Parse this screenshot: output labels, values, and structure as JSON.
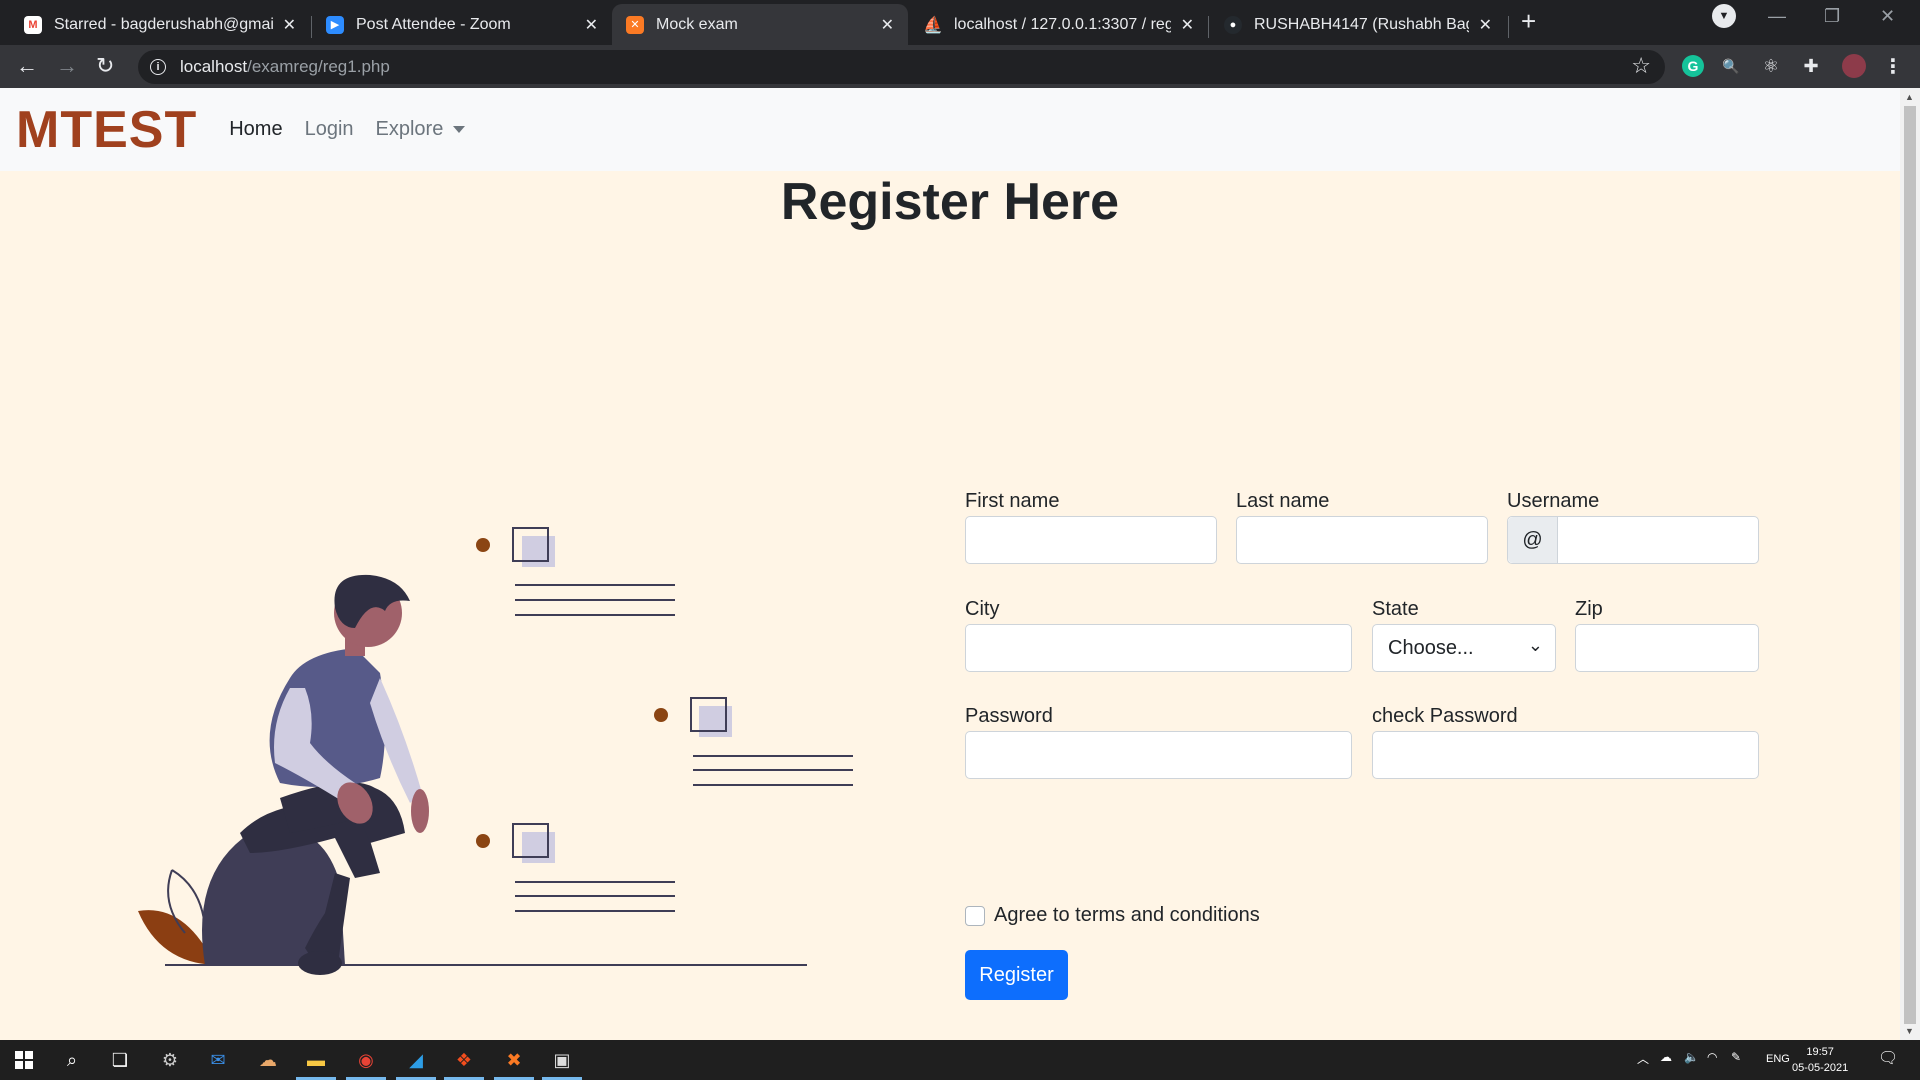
{
  "browser": {
    "tabs": [
      {
        "title": "Starred - bagderushabh@gmail.c",
        "favicon": "gmail-icon",
        "active": false
      },
      {
        "title": "Post Attendee - Zoom",
        "favicon": "zoom-icon",
        "active": false
      },
      {
        "title": "Mock exam",
        "favicon": "xampp-icon",
        "active": true
      },
      {
        "title": "localhost / 127.0.0.1:3307 / regist",
        "favicon": "phpmyadmin-icon",
        "active": false
      },
      {
        "title": "RUSHABH4147 (Rushabh Bagde)",
        "favicon": "github-icon",
        "active": false
      }
    ],
    "url_host": "localhost",
    "url_path": "/examreg/reg1.php"
  },
  "navbar": {
    "brand": "MTEST",
    "links": [
      "Home",
      "Login",
      "Explore"
    ]
  },
  "page": {
    "heading": "Register Here"
  },
  "form": {
    "first_name_label": "First name",
    "last_name_label": "Last name",
    "username_label": "Username",
    "username_prefix": "@",
    "city_label": "City",
    "state_label": "State",
    "state_selected": "Choose...",
    "zip_label": "Zip",
    "password_label": "Password",
    "check_password_label": "check Password",
    "terms_label": "Agree to terms and conditions",
    "submit_label": "Register"
  },
  "taskbar": {
    "language": "ENG",
    "time": "19:57",
    "date": "05-05-2021"
  },
  "colors": {
    "brand": "#a0411e",
    "page_bg": "#fff5e6",
    "primary_button": "#0d6efd"
  }
}
